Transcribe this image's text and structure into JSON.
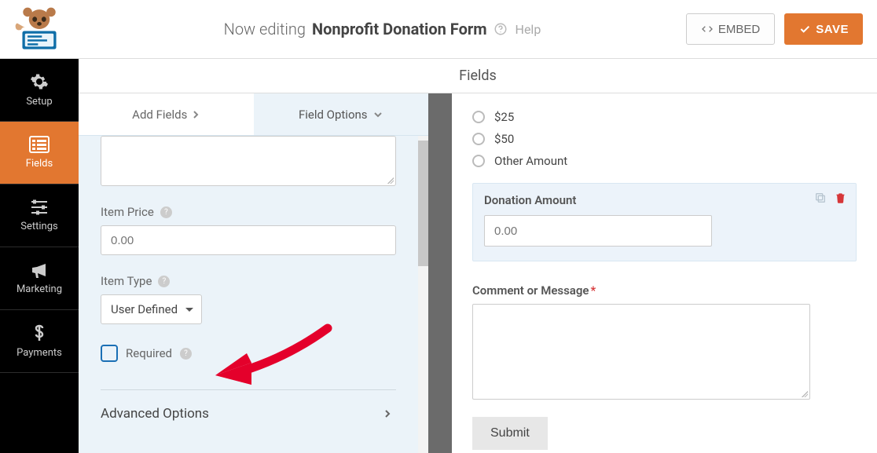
{
  "header": {
    "editing_prefix": "Now editing",
    "form_name": "Nonprofit Donation Form",
    "help_text": "Help",
    "embed_label": "EMBED",
    "save_label": "SAVE"
  },
  "sidebar": {
    "items": [
      {
        "icon": "gear",
        "label": "Setup"
      },
      {
        "icon": "fields",
        "label": "Fields"
      },
      {
        "icon": "sliders",
        "label": "Settings"
      },
      {
        "icon": "bullhorn",
        "label": "Marketing"
      },
      {
        "icon": "dollar",
        "label": "Payments"
      }
    ],
    "active_index": 1
  },
  "panel": {
    "title": "Fields",
    "tabs": {
      "add_fields": "Add Fields",
      "field_options": "Field Options"
    },
    "item_price": {
      "label": "Item Price",
      "placeholder": "0.00"
    },
    "item_type": {
      "label": "Item Type",
      "selected": "User Defined"
    },
    "required_label": "Required",
    "advanced_label": "Advanced Options"
  },
  "preview": {
    "amounts": [
      "$25",
      "$50",
      "Other Amount"
    ],
    "donation": {
      "title": "Donation Amount",
      "placeholder": "0.00"
    },
    "comment_label": "Comment or Message",
    "submit_label": "Submit"
  }
}
